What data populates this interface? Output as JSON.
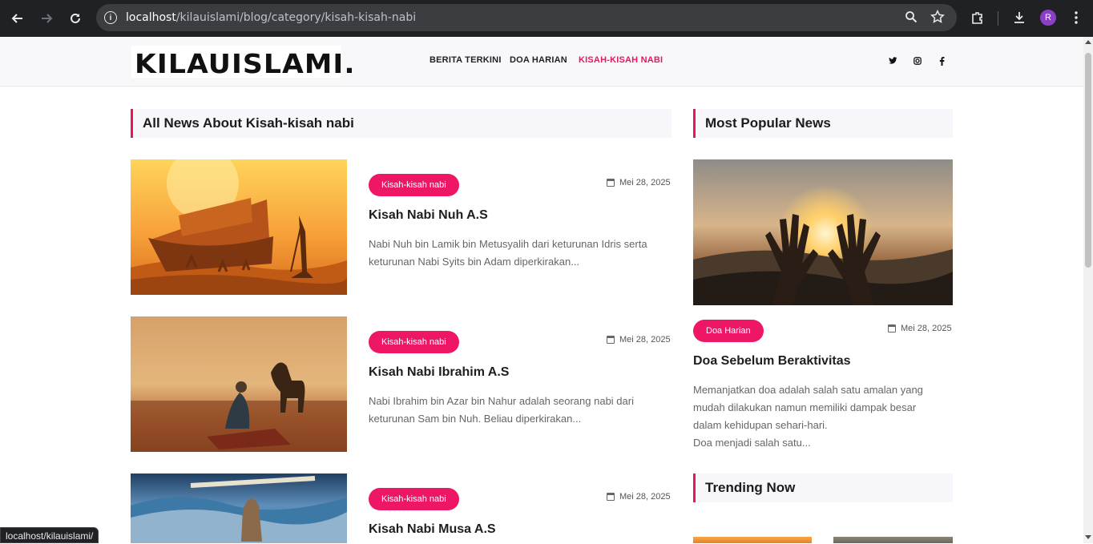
{
  "browser": {
    "url_host": "localhost",
    "url_path": "/kilauislami/blog/category/kisah-kisah-nabi",
    "profile_initial": "R",
    "status_url": "localhost/kilauislami/"
  },
  "site": {
    "logo": "KILAUISLAMI.",
    "menu": [
      "BERITA TERKINI",
      "DOA HARIAN",
      "KISAH-KISAH NABI"
    ],
    "active_menu": "KISAH-KISAH NABI",
    "social_icons": [
      "twitter-icon",
      "instagram-icon",
      "facebook-icon"
    ]
  },
  "main": {
    "section_title": "All News About Kisah-kisah nabi",
    "posts": [
      {
        "category": "Kisah-kisah nabi",
        "date": "Mei 28, 2025",
        "title": "Kisah Nabi Nuh A.S",
        "excerpt_line1": "Nabi Nuh bin Lamik bin Metusyalih dari keturunan Idris serta",
        "excerpt_line2": "keturunan Nabi Syits bin Adam diperkirakan..."
      },
      {
        "category": "Kisah-kisah nabi",
        "date": "Mei 28, 2025",
        "title": "Kisah Nabi Ibrahim A.S",
        "excerpt_line1": "Nabi Ibrahim bin Azar bin Nahur adalah seorang nabi dari",
        "excerpt_line2": "keturunan Sam bin Nuh. Beliau diperkirakan..."
      },
      {
        "category": "Kisah-kisah nabi",
        "date": "Mei 28, 2025",
        "title": "Kisah Nabi Musa A.S"
      }
    ]
  },
  "sidebar": {
    "popular_title": "Most Popular News",
    "popular_post": {
      "category": "Doa Harian",
      "date": "Mei 28, 2025",
      "title": "Doa Sebelum Beraktivitas",
      "excerpt_line1": "Memanjatkan doa adalah salah satu amalan yang",
      "excerpt_line2": "mudah dilakukan namun memiliki dampak besar",
      "excerpt_line3": "dalam kehidupan sehari-hari.",
      "excerpt_line4": "Doa menjadi salah satu..."
    },
    "trending_title": "Trending Now"
  },
  "colors": {
    "accent": "#ee1765",
    "chrome": "#202124"
  }
}
